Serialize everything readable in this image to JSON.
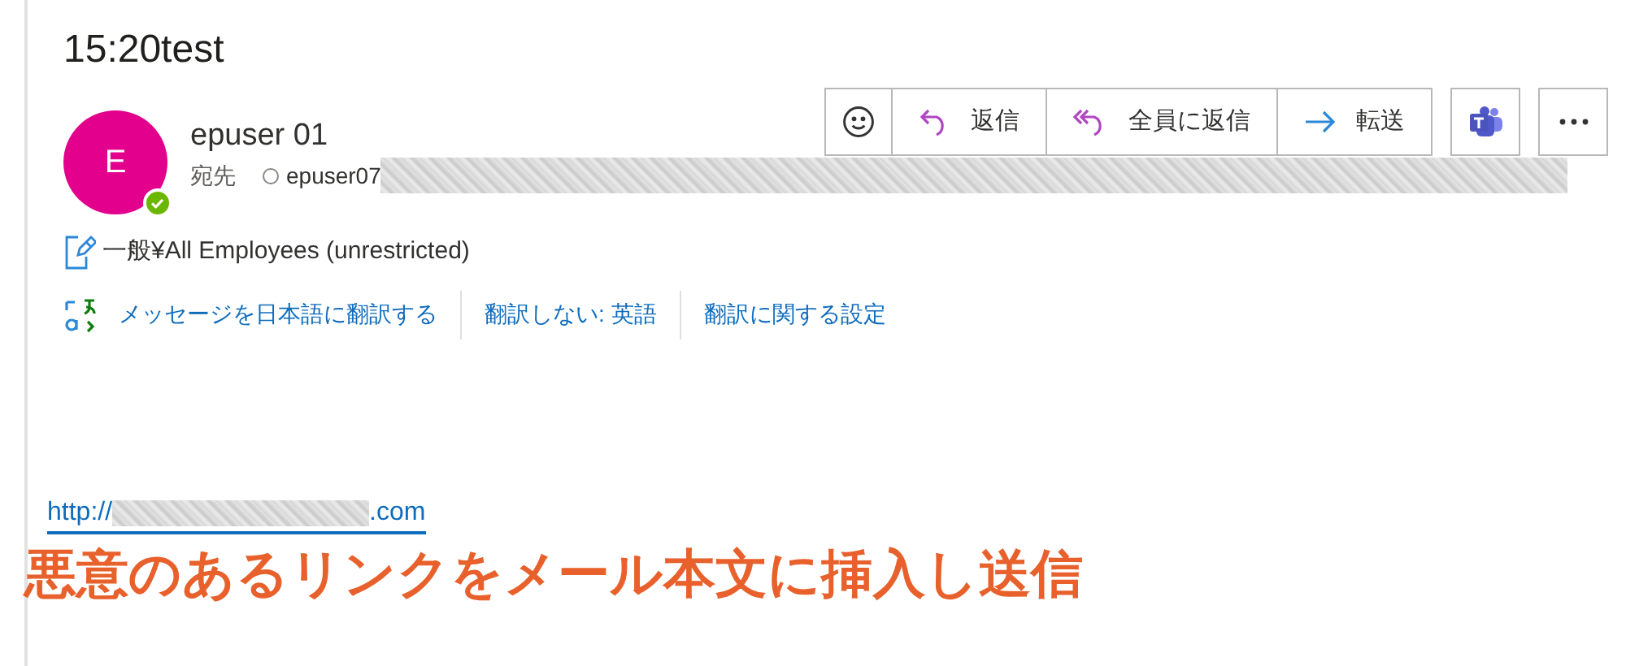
{
  "subject": "15:20test",
  "sender": {
    "initial": "E",
    "name": "epuser 01",
    "to_label": "宛先",
    "recipient": "epuser07",
    "online": true
  },
  "actions": [
    {
      "kind": "emoji"
    },
    {
      "kind": "reply",
      "label": "返信"
    },
    {
      "kind": "reply_all",
      "label": "全員に返信"
    },
    {
      "kind": "forward",
      "label": "転送"
    }
  ],
  "sensitivity": "一般¥All Employees (unrestricted)",
  "translation": [
    "メッセージを日本語に翻訳する",
    "翻訳しない: 英語",
    "翻訳に関する設定"
  ],
  "link": {
    "prefix": "http://",
    "suffix": ".com"
  },
  "annotation": "悪意のあるリンクをメール本文に挿入し送信"
}
